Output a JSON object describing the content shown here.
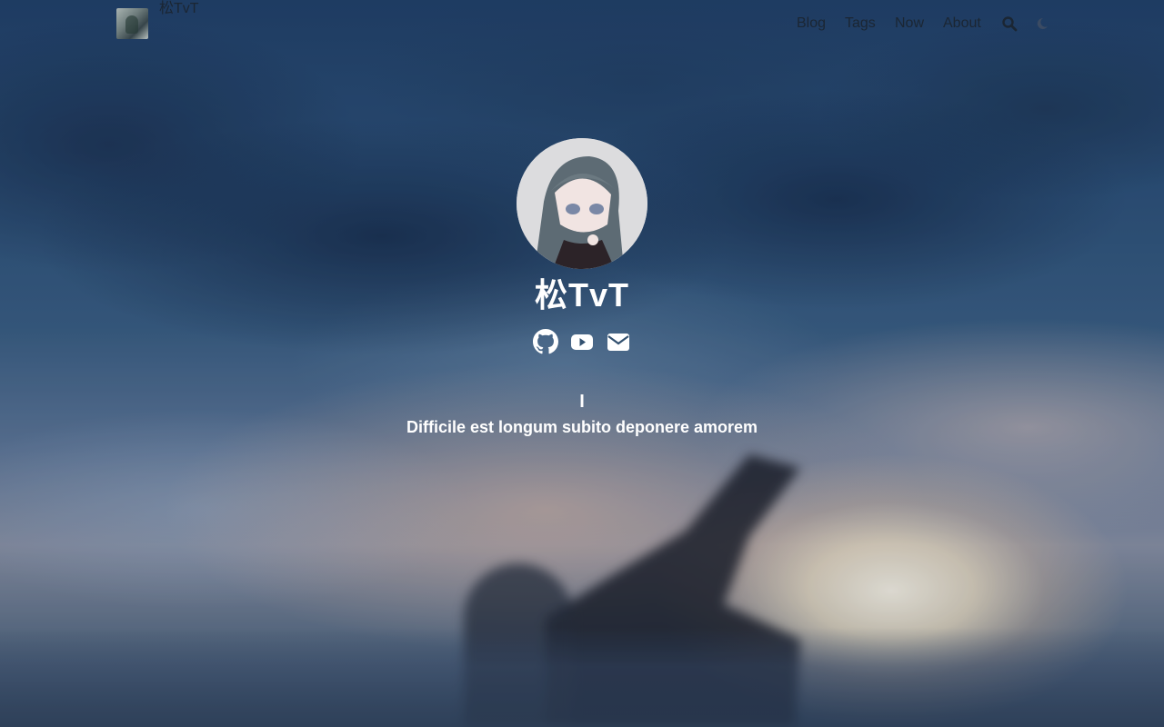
{
  "site": {
    "name": "松TvT"
  },
  "nav": {
    "items": [
      {
        "label": "Blog"
      },
      {
        "label": "Tags"
      },
      {
        "label": "Now"
      },
      {
        "label": "About"
      }
    ],
    "icons": [
      "search-icon",
      "moon-icon"
    ]
  },
  "profile": {
    "title": "松TvT",
    "cursor": "I",
    "tagline": "Difficile est longum subito deponere amorem",
    "socials": [
      "github-icon",
      "youtube-icon",
      "email-icon"
    ]
  },
  "colors": {
    "nav_text": "#1b2633",
    "hero_text": "#ffffff"
  }
}
